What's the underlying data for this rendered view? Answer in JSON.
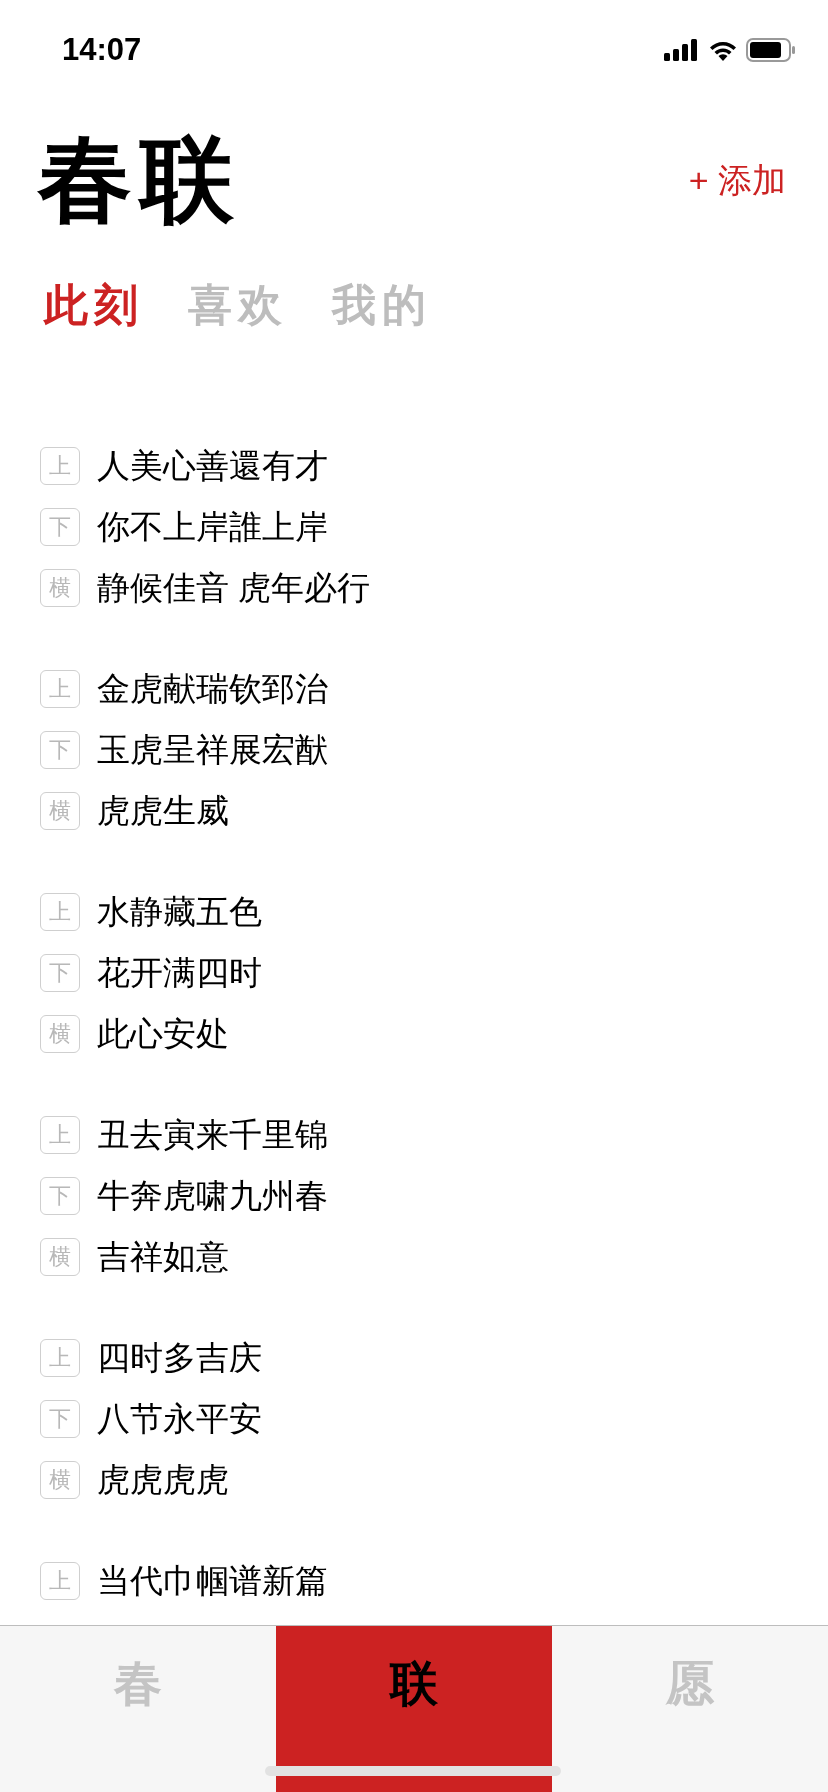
{
  "status_bar": {
    "time": "14:07"
  },
  "header": {
    "title": "春联",
    "add_button": "+ 添加"
  },
  "segments": [
    {
      "label": "此刻",
      "selected": true
    },
    {
      "label": "喜欢",
      "selected": false
    },
    {
      "label": "我的",
      "selected": false
    }
  ],
  "couplets": [
    {
      "lines": [
        {
          "tag": "上",
          "text": "人美心善還有才"
        },
        {
          "tag": "下",
          "text": "你不上岸誰上岸"
        },
        {
          "tag": "横",
          "text": "静候佳音 虎年必行"
        }
      ]
    },
    {
      "lines": [
        {
          "tag": "上",
          "text": "金虎献瑞钦郅治"
        },
        {
          "tag": "下",
          "text": "玉虎呈祥展宏猷"
        },
        {
          "tag": "横",
          "text": "虎虎生威"
        }
      ]
    },
    {
      "lines": [
        {
          "tag": "上",
          "text": "水静藏五色"
        },
        {
          "tag": "下",
          "text": "花开满四时"
        },
        {
          "tag": "横",
          "text": "此心安处"
        }
      ]
    },
    {
      "lines": [
        {
          "tag": "上",
          "text": "丑去寅来千里锦"
        },
        {
          "tag": "下",
          "text": "牛奔虎啸九州春"
        },
        {
          "tag": "横",
          "text": "吉祥如意"
        }
      ]
    },
    {
      "lines": [
        {
          "tag": "上",
          "text": "四时多吉庆"
        },
        {
          "tag": "下",
          "text": "八节永平安"
        },
        {
          "tag": "横",
          "text": "虎虎虎虎"
        }
      ]
    },
    {
      "lines": [
        {
          "tag": "上",
          "text": "当代巾帼谱新篇"
        }
      ]
    }
  ],
  "tab_bar": [
    {
      "label": "春",
      "selected": false
    },
    {
      "label": "联",
      "selected": true
    },
    {
      "label": "愿",
      "selected": false
    }
  ]
}
